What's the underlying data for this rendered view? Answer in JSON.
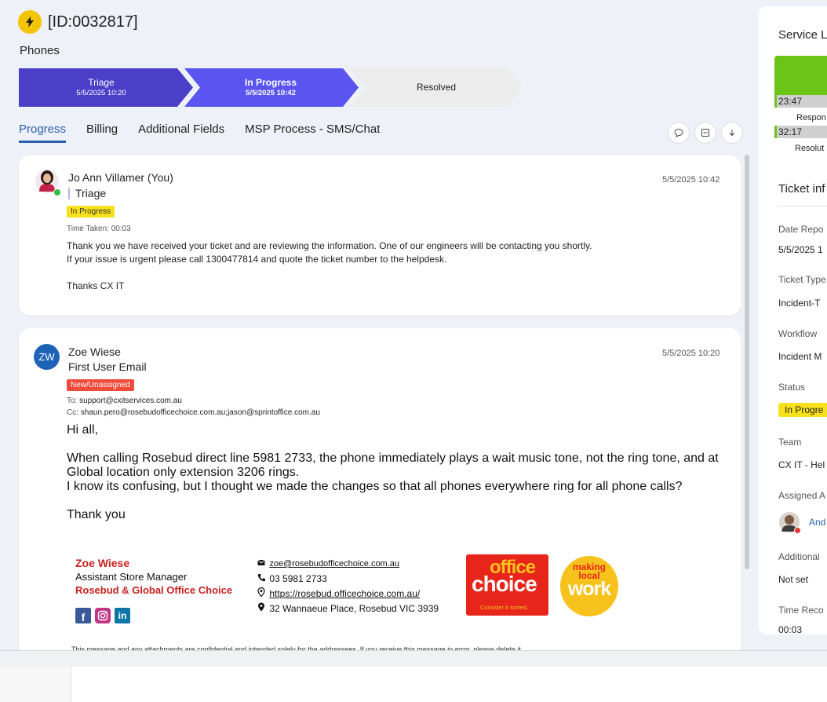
{
  "header": {
    "ticket_id": "[ID:0032817]",
    "category": "Phones"
  },
  "stages": [
    {
      "name": "Triage",
      "date": "5/5/2025 10:20",
      "color": "#4b3fc7"
    },
    {
      "name": "In Progress",
      "date": "5/5/2025 10:42",
      "color": "#5a55f0"
    },
    {
      "name": "Resolved",
      "date": "",
      "color": "#ececec"
    }
  ],
  "tabs": [
    "Progress",
    "Billing",
    "Additional Fields",
    "MSP Process - SMS/Chat"
  ],
  "actions": {
    "icons": [
      "chat-icon",
      "collapse-icon",
      "download-icon"
    ]
  },
  "note1": {
    "author": "Jo Ann Villamer (You)",
    "stage": "Triage",
    "status": "In Progress",
    "date": "5/5/2025 10:42",
    "time_taken": "Time Taken: 00:03",
    "line1": "Thank you we have received your ticket and are reviewing the information. One of our engineers will be contacting you shortly.",
    "line2": "If your issue is urgent please call 1300477814 and quote the ticket number to the helpdesk.",
    "line3": "Thanks CX IT"
  },
  "note2": {
    "initials": "ZW",
    "author": "Zoe Wiese",
    "subject": "First User Email",
    "status": "New/Unassigned",
    "date": "5/5/2025 10:20",
    "to_label": "To:",
    "to": "support@cxitservices.com.au",
    "cc_label": "Cc:",
    "cc": "shaun.pero@rosebudofficechoice.com.au;jason@sprintoffice.com.au",
    "greeting": "Hi all,",
    "para1a": "When calling Rosebud direct line 5981 2733, the phone immediately plays a wait music tone, not the ring tone, and at",
    "para1b": "Global location only extension 3206 rings.",
    "para2": "I know its confusing, but I thought we made the changes so that all phones everywhere ring for all phone calls?",
    "thanks": "Thank you",
    "sig_name": "Zoe Wiese",
    "sig_title": "Assistant Store Manager",
    "sig_company": "Rosebud & Global Office Choice",
    "sig_email": "zoe@rosebudofficechoice.com.au",
    "sig_phone": "03 5981 2733",
    "sig_url": "https://rosebud.officechoice.com.au/",
    "sig_address": "32 Wannaeue Place, Rosebud VIC 3939",
    "logo1_top": "office",
    "logo1_bottom": "choice",
    "logo1_tag": "Consider it sorted.",
    "logo2_l1": "making",
    "logo2_l2": "local",
    "logo2_l3": "work",
    "disclaimer": "This message and any attachments are confidential and intended solely for the addressees. If you receive this message in error, please delete it."
  },
  "right_panel": {
    "service_title": "Service L",
    "sla1_time": "23:47",
    "sla1_label": "Respon",
    "sla2_time": "32:17",
    "sla2_label": "Resolut",
    "ticket_info": "Ticket inf",
    "date_reported_label": "Date Repo",
    "date_reported": "5/5/2025 1",
    "ticket_type_label": "Ticket Type",
    "ticket_type": "Incident-T",
    "workflow_label": "Workflow",
    "workflow": "Incident M",
    "status_label": "Status",
    "status": "In Progre",
    "team_label": "Team",
    "team": "CX IT - Hel",
    "assigned_label": "Assigned A",
    "assigned": "And",
    "additional_label": "Additional",
    "additional": "Not set",
    "time_label": "Time Reco",
    "time": "00:03"
  },
  "colors": {
    "accent": "#2b5fb0",
    "sla_green": "#6cc417",
    "badge_yellow": "#f7e11a",
    "badge_red": "#ef4a3a",
    "brand_red": "#c8201f"
  }
}
